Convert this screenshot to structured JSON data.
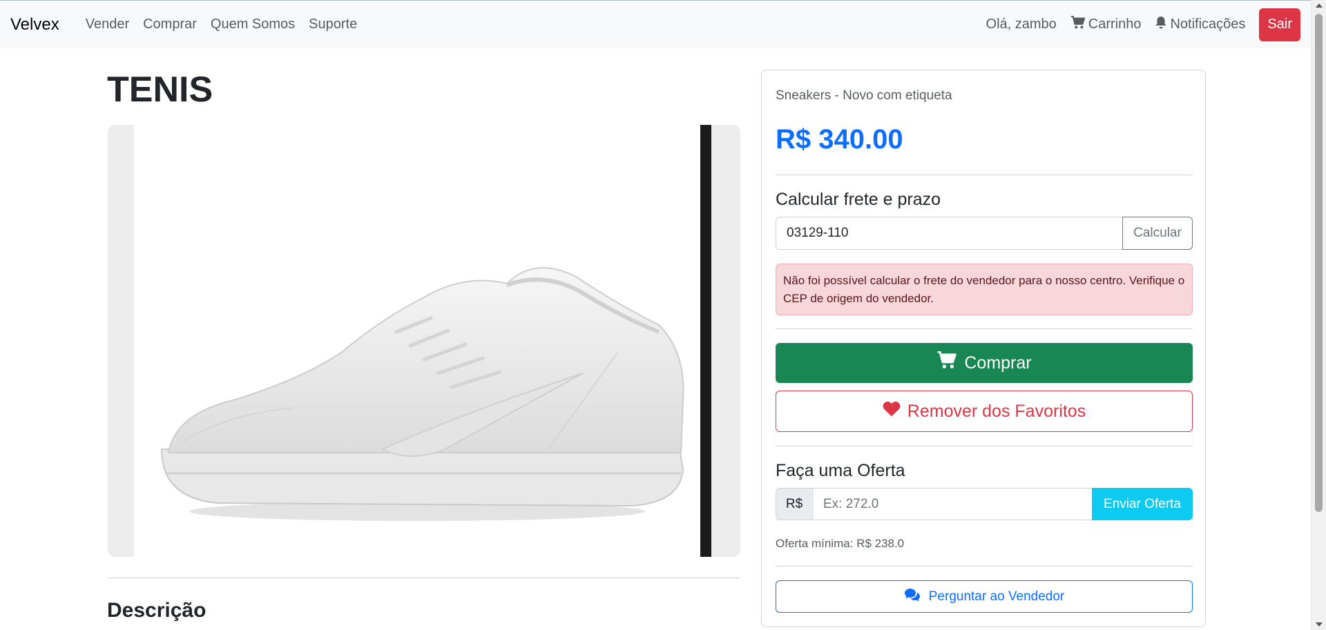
{
  "navbar": {
    "brand": "Velvex",
    "links": [
      "Vender",
      "Comprar",
      "Quem Somos",
      "Suporte"
    ],
    "greeting": "Olá, zambo",
    "cart_label": "Carrinho",
    "notifications_label": "Notificações",
    "logout_label": "Sair"
  },
  "product": {
    "title": "TENIS",
    "subtitle": "Sneakers - Novo com etiqueta",
    "price": "R$ 340.00",
    "description_heading": "Descrição"
  },
  "shipping": {
    "heading": "Calcular frete e prazo",
    "cep_value": "03129-110",
    "calculate_label": "Calcular",
    "error_message": "Não foi possível calcular o frete do vendedor para o nosso centro. Verifique o CEP de origem do vendedor."
  },
  "actions": {
    "buy_label": "Comprar",
    "favorite_label": "Remover dos Favoritos",
    "ask_seller_label": "Perguntar ao Vendedor"
  },
  "offer": {
    "heading": "Faça uma Oferta",
    "currency": "R$",
    "placeholder": "Ex: 272.0",
    "submit_label": "Enviar Oferta",
    "minimum": "Oferta mínima: R$ 238.0"
  },
  "colors": {
    "primary": "#0d6efd",
    "success": "#198754",
    "danger": "#dc3545",
    "info": "#0dcaf0",
    "alert_bg": "#f8d7da"
  },
  "icons": {
    "cart": "cart-icon",
    "bell": "bell-icon",
    "heart": "heart-icon",
    "chat": "chat-icon"
  }
}
